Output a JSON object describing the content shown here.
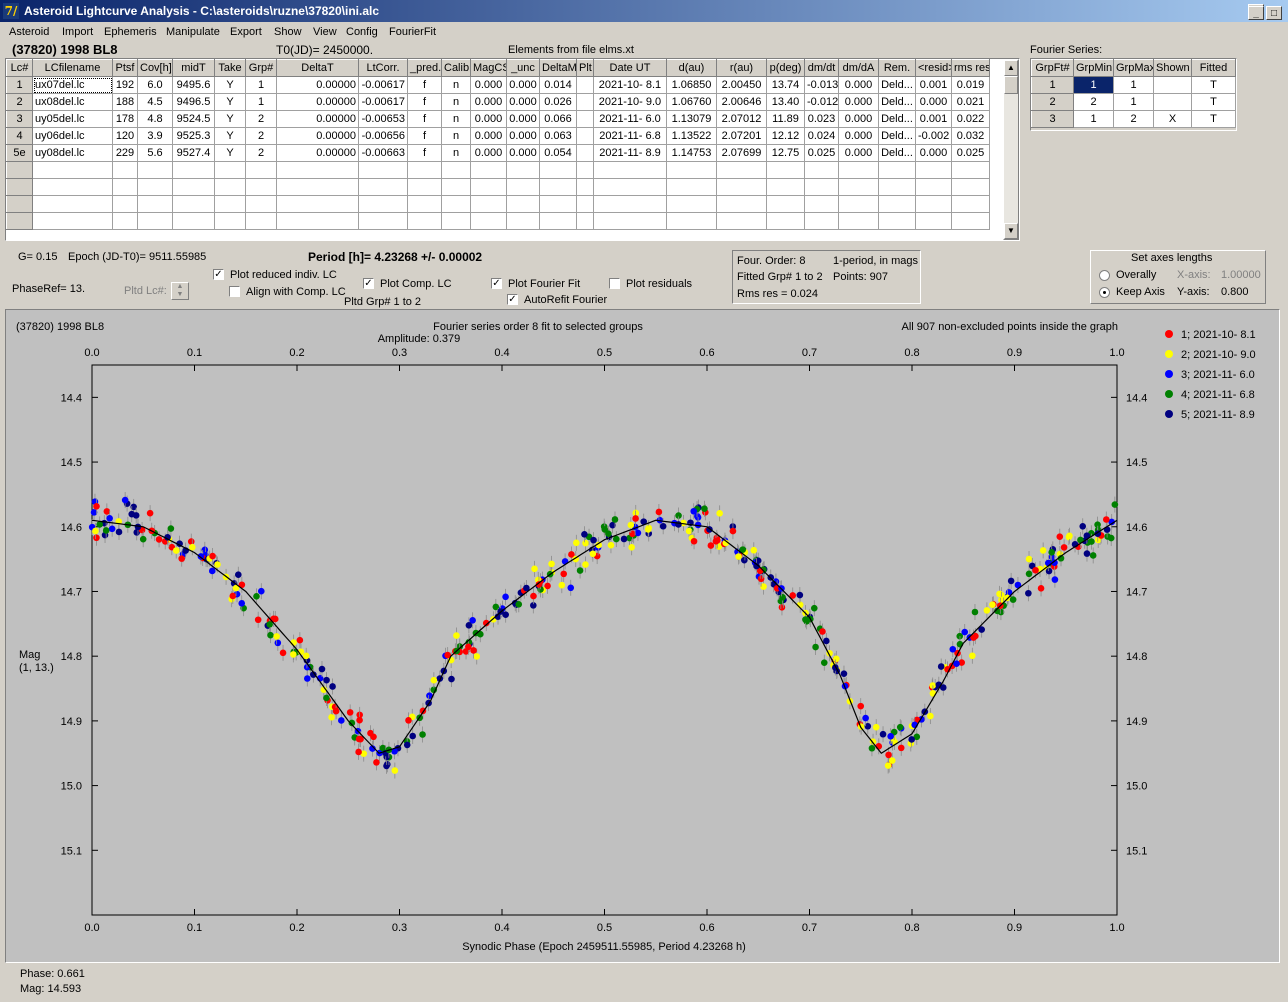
{
  "window": {
    "title": "Asteroid Lightcurve Analysis - C:\\asteroids\\ruzne\\37820\\ini.alc",
    "icon_letter": "7/"
  },
  "menu": [
    "Asteroid",
    "Import",
    "Ephemeris",
    "Manipulate",
    "Export",
    "Show",
    "View",
    "Config",
    "FourierFit"
  ],
  "header": {
    "asteroid": "(37820) 1998 BL8",
    "t0": "T0(JD)= 2450000.",
    "elements": "Elements from file elms.xt"
  },
  "lc_table": {
    "columns": [
      "Lc#",
      "LCfilename",
      "Ptsf",
      "Cov[h]",
      "midT",
      "Take",
      "Grp#",
      "DeltaT",
      "LtCorr.",
      "_pred.",
      "Calib.",
      "MagCS",
      "_unc",
      "DeltaM",
      "Plt",
      "Date UT",
      "d(au)",
      "r(au)",
      "p(deg)",
      "dm/dt",
      "dm/dA",
      "Rem.",
      "<resid>",
      "rms res"
    ],
    "rows": [
      [
        "1",
        "ux07del.lc",
        "192",
        "6.0",
        "9495.6",
        "Y",
        "1",
        "0.00000",
        "-0.00617",
        "f",
        "n",
        "0.000",
        "0.000",
        "0.014",
        "",
        "2021-10- 8.1",
        "1.06850",
        "2.00450",
        "13.74",
        "-0.013",
        "0.000",
        "Deld...",
        "0.001",
        "0.019"
      ],
      [
        "2",
        "ux08del.lc",
        "188",
        "4.5",
        "9496.5",
        "Y",
        "1",
        "0.00000",
        "-0.00617",
        "f",
        "n",
        "0.000",
        "0.000",
        "0.026",
        "",
        "2021-10- 9.0",
        "1.06760",
        "2.00646",
        "13.40",
        "-0.012",
        "0.000",
        "Deld...",
        "0.000",
        "0.021"
      ],
      [
        "3",
        "uy05del.lc",
        "178",
        "4.8",
        "9524.5",
        "Y",
        "2",
        "0.00000",
        "-0.00653",
        "f",
        "n",
        "0.000",
        "0.000",
        "0.066",
        "",
        "2021-11- 6.0",
        "1.13079",
        "2.07012",
        "11.89",
        "0.023",
        "0.000",
        "Deld...",
        "0.001",
        "0.022"
      ],
      [
        "4",
        "uy06del.lc",
        "120",
        "3.9",
        "9525.3",
        "Y",
        "2",
        "0.00000",
        "-0.00656",
        "f",
        "n",
        "0.000",
        "0.000",
        "0.063",
        "",
        "2021-11- 6.8",
        "1.13522",
        "2.07201",
        "12.12",
        "0.024",
        "0.000",
        "Deld...",
        "-0.002",
        "0.032"
      ],
      [
        "5e",
        "uy08del.lc",
        "229",
        "5.6",
        "9527.4",
        "Y",
        "2",
        "0.00000",
        "-0.00663",
        "f",
        "n",
        "0.000",
        "0.000",
        "0.054",
        "",
        "2021-11- 8.9",
        "1.14753",
        "2.07699",
        "12.75",
        "0.025",
        "0.000",
        "Deld...",
        "0.000",
        "0.025"
      ]
    ]
  },
  "fourier_table": {
    "label": "Fourier Series:",
    "columns": [
      "GrpFt#",
      "GrpMin",
      "GrpMax",
      "Shown",
      "Fitted"
    ],
    "rows": [
      [
        "1",
        "1",
        "1",
        "",
        "T"
      ],
      [
        "2",
        "2",
        "1",
        "",
        "T"
      ],
      [
        "3",
        "1",
        "2",
        "X",
        "T"
      ]
    ]
  },
  "params": {
    "g": "G= 0.15",
    "epoch": "Epoch (JD-T0)= 9511.55985",
    "period": "Period [h]= 4.23268 +/- 0.00002",
    "phaseref": "PhaseRef= 13.",
    "pltd_lc": "Pltd Lc#:",
    "pltd_grp": "Pltd Grp#   1   to    2",
    "plot_reduced": "Plot reduced indiv. LC",
    "align_comp": "Align with Comp. LC",
    "plot_comp": "Plot Comp. LC",
    "plot_fourier": "Plot Fourier Fit",
    "autorefit": "AutoRefit Fourier",
    "plot_residuals": "Plot residuals"
  },
  "fourier_info": {
    "order": "Four. Order:  8",
    "period_mode": "1-period, in mags",
    "fitted": "Fitted Grp# 1 to 2",
    "points": "Points: 907",
    "rms": "Rms res     = 0.024"
  },
  "axes_box": {
    "title": "Set axes lengths",
    "overally": "Overally",
    "keep": "Keep Axis",
    "xaxis_label": "X-axis:",
    "xaxis_val": "1.00000",
    "yaxis_label": "Y-axis:",
    "yaxis_val": "0.800"
  },
  "status": {
    "phase": "Phase:  0.661",
    "mag": "Mag:    14.593"
  },
  "chart_data": {
    "type": "scatter",
    "title_left": "(37820) 1998 BL8",
    "title_center": "Fourier series order 8 fit to selected groups",
    "amplitude": "Amplitude: 0.379",
    "title_right": "All 907 non-excluded points inside the graph",
    "xlabel": "Synodic Phase (Epoch 2459511.55985, Period 4.23268 h)",
    "ylabel": [
      "Mag",
      "(1, 13.)"
    ],
    "xlim": [
      0.0,
      1.0
    ],
    "ylim": [
      15.2,
      14.35
    ],
    "xticks": [
      "0.0",
      "0.1",
      "0.2",
      "0.3",
      "0.4",
      "0.5",
      "0.6",
      "0.7",
      "0.8",
      "0.9",
      "1.0"
    ],
    "yticks": [
      "14.4",
      "14.5",
      "14.6",
      "14.7",
      "14.8",
      "14.9",
      "15.0",
      "15.1"
    ],
    "fourier_curve": [
      [
        0.0,
        14.59
      ],
      [
        0.05,
        14.6
      ],
      [
        0.1,
        14.64
      ],
      [
        0.15,
        14.7
      ],
      [
        0.2,
        14.79
      ],
      [
        0.25,
        14.9
      ],
      [
        0.28,
        14.95
      ],
      [
        0.3,
        14.94
      ],
      [
        0.33,
        14.87
      ],
      [
        0.35,
        14.8
      ],
      [
        0.4,
        14.73
      ],
      [
        0.45,
        14.67
      ],
      [
        0.5,
        14.62
      ],
      [
        0.55,
        14.59
      ],
      [
        0.6,
        14.6
      ],
      [
        0.65,
        14.66
      ],
      [
        0.7,
        14.74
      ],
      [
        0.73,
        14.83
      ],
      [
        0.75,
        14.91
      ],
      [
        0.77,
        14.95
      ],
      [
        0.8,
        14.92
      ],
      [
        0.83,
        14.84
      ],
      [
        0.85,
        14.78
      ],
      [
        0.9,
        14.7
      ],
      [
        0.95,
        14.64
      ],
      [
        1.0,
        14.59
      ]
    ],
    "series": [
      {
        "name": "1; 2021-10- 8.1",
        "color": "#ff0000"
      },
      {
        "name": "2; 2021-10- 9.0",
        "color": "#ffff00"
      },
      {
        "name": "3; 2021-11- 6.0",
        "color": "#0000ff"
      },
      {
        "name": "4; 2021-11- 6.8",
        "color": "#008000"
      },
      {
        "name": "5; 2021-11- 8.9",
        "color": "#000080"
      }
    ]
  }
}
